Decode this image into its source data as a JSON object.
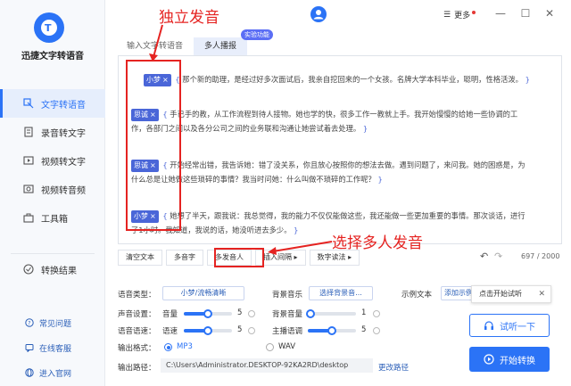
{
  "app": {
    "name": "迅捷文字转语音",
    "logo_letter": "T"
  },
  "sidebar": {
    "items": [
      {
        "label": "文字转语音",
        "icon": "text-to-speech-icon"
      },
      {
        "label": "录音转文字",
        "icon": "record-icon"
      },
      {
        "label": "视频转文字",
        "icon": "video-text-icon"
      },
      {
        "label": "视频转音频",
        "icon": "video-audio-icon"
      },
      {
        "label": "工具箱",
        "icon": "toolbox-icon"
      }
    ],
    "results": "转换结果",
    "footer": [
      "常见问题",
      "在线客服",
      "进入官网"
    ]
  },
  "topbar": {
    "more": "更多",
    "minimize": "—",
    "maximize": "☐",
    "close": "✕"
  },
  "tabs": [
    "输入文字转语音",
    "多人播报"
  ],
  "badge": "实验功能",
  "editor": {
    "paragraphs": [
      {
        "tag": "小梦",
        "text": "那个新的助理，是经过好多次面试后，我亲自挖回来的一个女孩。名牌大学本科毕业，聪明，性格活泼。"
      },
      {
        "tag": "思诚",
        "text": "手已手的教，从工作流程到待人接物。她也学的快，很多工作一教就上手。我开始慢慢的给她一些协调的工",
        "cont": "作，各部门之间以及各分公司之间的业务联和沟通让她尝试着去处理。"
      },
      {
        "tag": "思诚",
        "text": "开始经常出错，我告诉她：错了没关系，你且放心按照你的想法去做。遇到问题了，来问我。她的困惑是，为",
        "cont": "什么总是让她做这些琐碎的事情？我当时问她：什么叫做不琐碎的工作呢？"
      },
      {
        "tag": "小梦",
        "text": "她想了半天，跟我说：我总觉得，我的能力不仅仅能做这些，我还能做一些更加重要的事情。那次谈话，进行",
        "cont": "了1小时。我知道，我说的话，她没听进去多少。"
      }
    ],
    "tag_close": "×"
  },
  "toolbar": {
    "buttons": [
      "清空文本",
      "多音字",
      "多发音人",
      "插入间隔 ▸",
      "数字读法 ▸"
    ],
    "undo": "↶",
    "redo": "↷",
    "counter": "697 / 2000"
  },
  "annotations": {
    "top": "独立发音",
    "bottom": "选择多人发音"
  },
  "settings": {
    "voice_type_label": "语音类型：",
    "voice_type_value": "小梦/流畅清晰",
    "bg_music_label": "背景音乐",
    "bg_music_value": "选择背景音...",
    "sample_label": "示例文本",
    "sample_value": "添加示例",
    "sound_label": "声音设置：",
    "volume_label": "音量",
    "volume_value": "5",
    "volume_level": 0.5,
    "bg_volume_label": "背景音量",
    "bg_volume_value": "1",
    "bg_volume_level": 0.05,
    "speed_label": "语音语速：",
    "speed_sub_label": "语速",
    "speed_value": "5",
    "speed_level": 0.5,
    "pitch_label": "主播语调",
    "pitch_value": "5",
    "pitch_level": 0.5,
    "format_label": "输出格式：",
    "format_mp3": "MP3",
    "format_wav": "WAV",
    "path_label": "输出路径：",
    "path_value": "C:\\Users\\Administrator.DESKTOP-92KA2RD\\desktop",
    "change_path": "更改路径"
  },
  "tooltip": {
    "text": "点击开始试听",
    "close": "✕"
  },
  "actions": {
    "listen": "试听一下",
    "start": "开始转换"
  },
  "colors": {
    "accent": "#2b73f6",
    "annotation": "#e52321",
    "tag": "#4a66d8"
  }
}
